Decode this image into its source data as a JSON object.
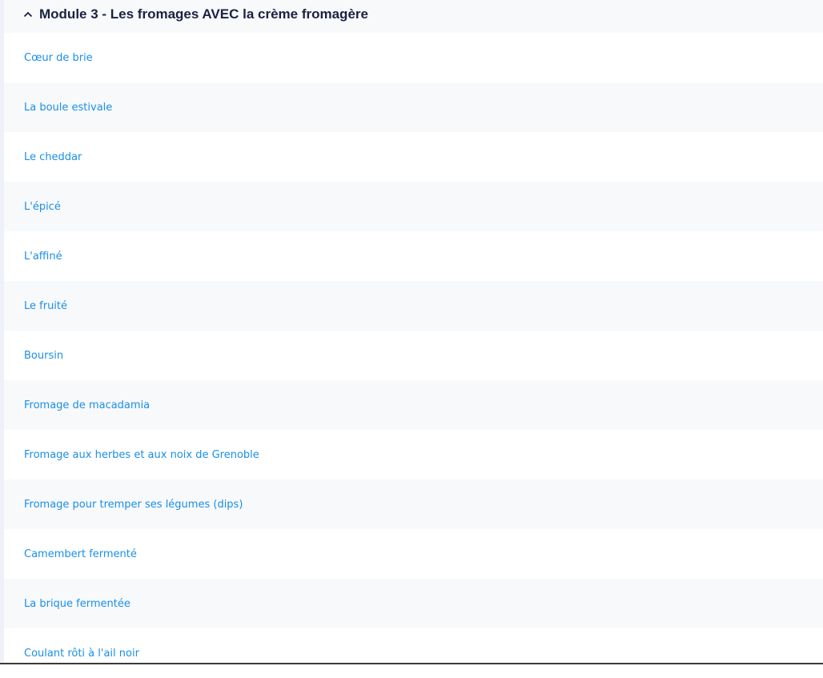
{
  "module": {
    "title": "Module 3 - Les fromages AVEC la crème fromagère",
    "expanded": true,
    "lessons": [
      "Cœur de brie",
      "La boule estivale",
      "Le cheddar",
      "L'épicé",
      "L'affiné",
      "Le fruité",
      "Boursin",
      "Fromage de macadamia",
      "Fromage aux herbes et aux noix de Grenoble",
      "Fromage pour tremper ses légumes (dips)",
      "Camembert fermenté",
      "La brique fermentée",
      "Coulant rôti à l'ail noir"
    ]
  },
  "colors": {
    "link": "#1a8fe8",
    "title": "#1a2240",
    "alt_row": "#f8f9fb"
  }
}
